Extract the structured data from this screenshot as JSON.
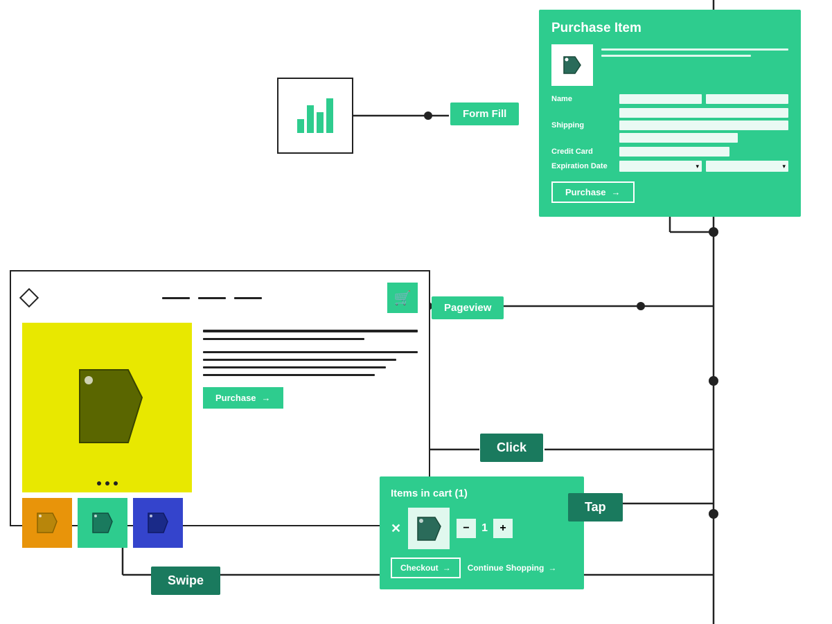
{
  "nodes": {
    "form_fill": {
      "label": "Form Fill"
    },
    "purchase_card": {
      "title": "Purchase Item",
      "name_label": "Name",
      "shipping_label": "Shipping",
      "credit_card_label": "Credit Card",
      "expiration_label": "Expiration Date",
      "button": "Purchase"
    },
    "pageview": {
      "label": "Pageview"
    },
    "click": {
      "label": "Click"
    },
    "tap": {
      "label": "Tap"
    },
    "swipe": {
      "label": "Swipe"
    },
    "cart": {
      "title": "Items in cart (1)",
      "qty": "1",
      "checkout": "Checkout",
      "continue": "Continue Shopping"
    },
    "product": {
      "purchase_btn": "Purchase"
    }
  }
}
